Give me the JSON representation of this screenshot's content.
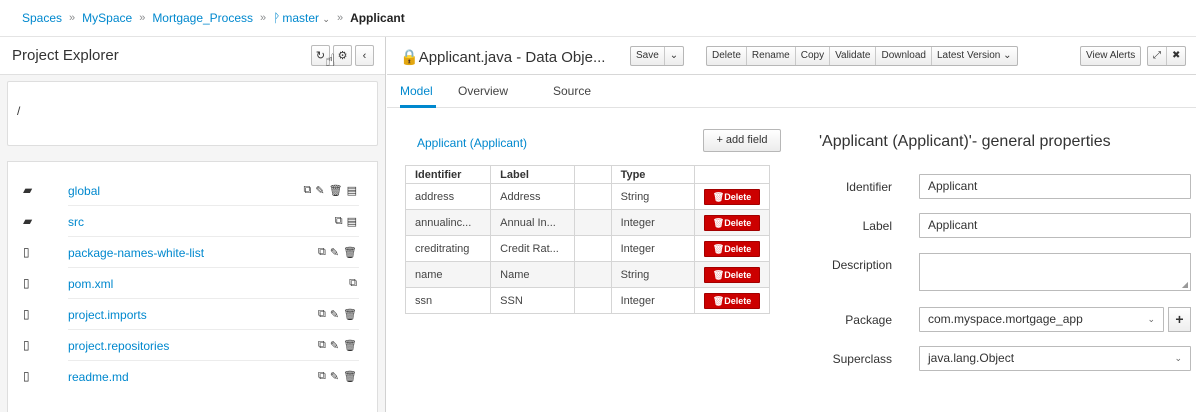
{
  "breadcrumb": {
    "items": [
      "Spaces",
      "MySpace",
      "Mortgage_Process"
    ],
    "branch": "master",
    "current": "Applicant"
  },
  "explorer": {
    "title": "Project Explorer",
    "path": "/",
    "files": [
      {
        "name": "global",
        "kind": "folder",
        "actions": [
          "copy",
          "rename",
          "delete",
          "archive"
        ]
      },
      {
        "name": "src",
        "kind": "folder",
        "actions": [
          "copy",
          "archive"
        ]
      },
      {
        "name": "package-names-white-list",
        "kind": "file",
        "actions": [
          "copy",
          "rename",
          "delete"
        ]
      },
      {
        "name": "pom.xml",
        "kind": "file",
        "actions": [
          "copy"
        ]
      },
      {
        "name": "project.imports",
        "kind": "file",
        "actions": [
          "copy",
          "rename",
          "delete"
        ]
      },
      {
        "name": "project.repositories",
        "kind": "file",
        "actions": [
          "copy",
          "rename",
          "delete"
        ]
      },
      {
        "name": "readme.md",
        "kind": "file",
        "actions": [
          "copy",
          "rename",
          "delete"
        ]
      }
    ]
  },
  "editor": {
    "title": "Applicant.java - Data Obje...",
    "toolbar": {
      "save": "Save",
      "delete": "Delete",
      "rename": "Rename",
      "copy": "Copy",
      "validate": "Validate",
      "download": "Download",
      "latest_version": "Latest Version",
      "view_alerts": "View Alerts"
    },
    "tabs": [
      "Model",
      "Overview",
      "Source"
    ],
    "active_tab": "Model"
  },
  "fields": {
    "title": "Applicant (Applicant)",
    "add_label": "+ add field",
    "headers": [
      "Identifier",
      "Label",
      "",
      "Type",
      ""
    ],
    "delete_label": "Delete",
    "rows": [
      {
        "identifier": "address",
        "label": "Address",
        "type": "String"
      },
      {
        "identifier": "annualinc...",
        "label": "Annual In...",
        "type": "Integer"
      },
      {
        "identifier": "creditrating",
        "label": "Credit Rat...",
        "type": "Integer"
      },
      {
        "identifier": "name",
        "label": "Name",
        "type": "String"
      },
      {
        "identifier": "ssn",
        "label": "SSN",
        "type": "Integer"
      }
    ]
  },
  "properties": {
    "title": "'Applicant (Applicant)'- general properties",
    "identifier_label": "Identifier",
    "identifier_value": "Applicant",
    "label_label": "Label",
    "label_value": "Applicant",
    "description_label": "Description",
    "description_value": "",
    "package_label": "Package",
    "package_value": "com.myspace.mortgage_app",
    "superclass_label": "Superclass",
    "superclass_value": "java.lang.Object"
  },
  "colors": {
    "link": "#0088ce",
    "delete": "#cc0000"
  }
}
